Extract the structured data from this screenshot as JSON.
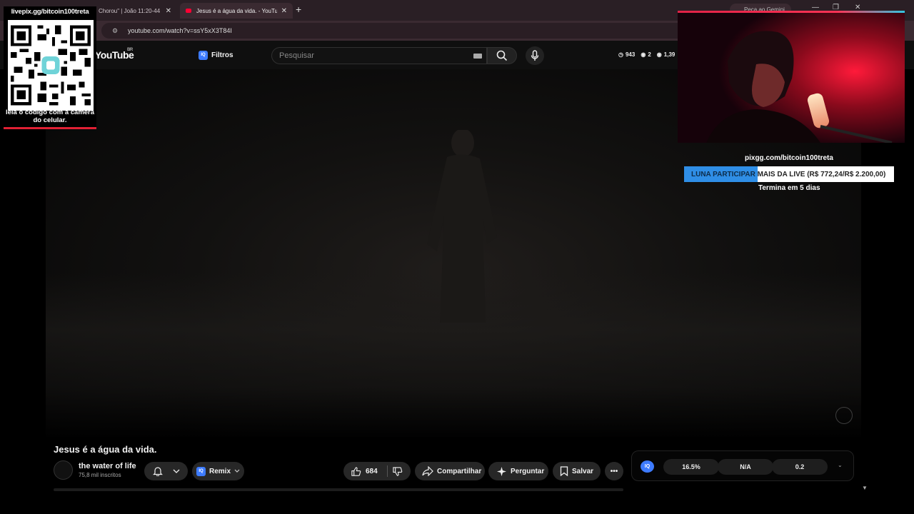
{
  "browser": {
    "tabs": [
      {
        "title": "Chorou\" | João 11:20-44"
      },
      {
        "title": "Jesus é a água da vida. - YouTube"
      }
    ],
    "new_tab": "+",
    "gemini_label": "Peça ao Gemini",
    "url": "youtube.com/watch?v=ssY5xX3T84I"
  },
  "youtube": {
    "logo": "YouTube",
    "region": "BR",
    "filters_label": "Filtros",
    "search_placeholder": "Pesquisar",
    "stats": [
      "943",
      "2",
      "1,39"
    ]
  },
  "video": {
    "title": "Jesus é a água da vida.",
    "channel_name": "the water of life",
    "subscribers": "75,8 mil inscritos",
    "remix_label": "Remix",
    "likes": "684",
    "share_label": "Compartilhar",
    "ask_label": "Perguntar",
    "save_label": "Salvar"
  },
  "iq_widget": {
    "badge": "IQ",
    "values": [
      "16.5%",
      "N/A",
      "0.2"
    ]
  },
  "overlay": {
    "qr_url": "livepix.gg/bitcoin100treta",
    "qr_caption": "leia o código com a câmera do celular.",
    "pix_url": "pixgg.com/bitcoin100treta",
    "goal_highlight": "LUNA PARTICIPAR",
    "goal_text": " MAIS DA LIVE (R$ 772,24/R$ 2.200,00)",
    "goal_progress": 0.351,
    "goal_ends": "Termina em 5 dias"
  },
  "colors": {
    "accent_red": "#e02034",
    "goal_blue": "#2f8ee6",
    "iq_blue": "#3d7bff"
  }
}
